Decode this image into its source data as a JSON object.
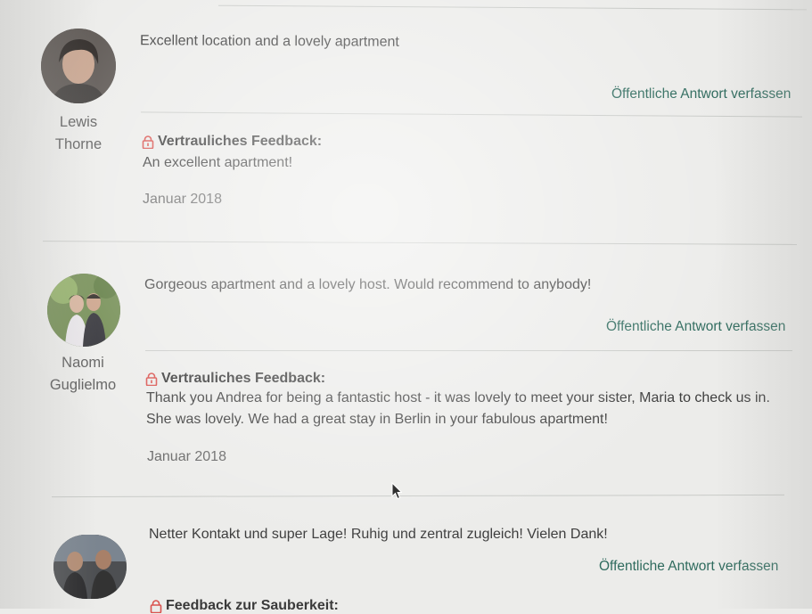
{
  "reviews": [
    {
      "author_first": "Lewis",
      "author_last": "Thorne",
      "text": "Excellent location and a lovely apartment",
      "reply_label": "Öffentliche Antwort verfassen",
      "feedback_title": "Vertrauliches Feedback:",
      "feedback_lines": [
        "An excellent apartment!"
      ],
      "date": "Januar 2018"
    },
    {
      "author_first": "Naomi",
      "author_last": "Guglielmo",
      "text": "Gorgeous apartment and a lovely host. Would recommend to anybody!",
      "reply_label": "Öffentliche Antwort verfassen",
      "feedback_title": "Vertrauliches Feedback:",
      "feedback_lines": [
        "Thank you Andrea for being a fantastic host - it was lovely to meet your sister, Maria to check us in.",
        "She was lovely. We had a great stay in Berlin in your fabulous apartment!"
      ],
      "date": "Januar 2018"
    },
    {
      "text": "Netter Kontakt und super Lage! Ruhig und zentral zugleich! Vielen Dank!",
      "reply_label": "Öffentliche Antwort verfassen",
      "feedback_title": "Feedback zur Sauberkeit:"
    }
  ],
  "colors": {
    "link": "#2f6b5e",
    "lock": "#d9534f",
    "divider": "#c9cbc8"
  }
}
